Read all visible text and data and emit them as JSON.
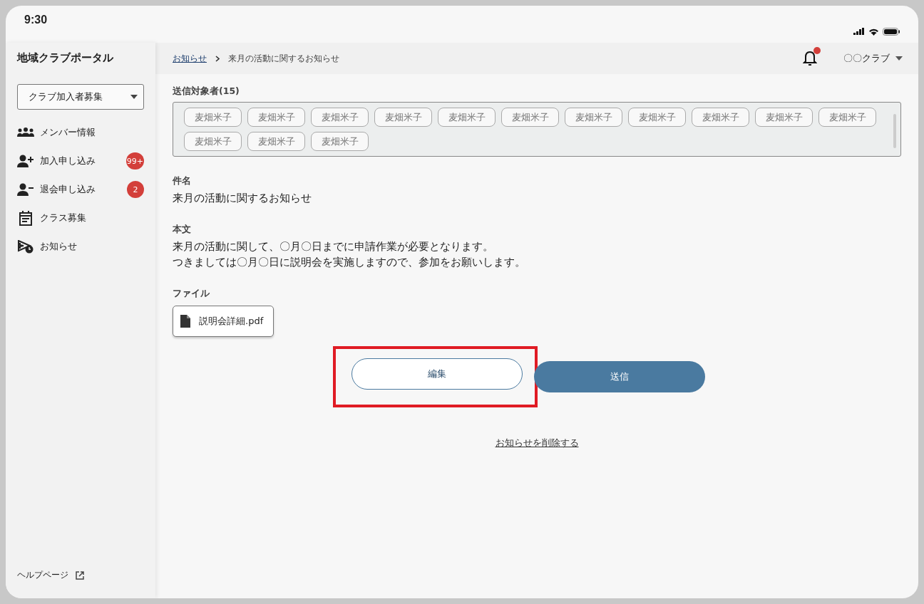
{
  "status_bar": {
    "time": "9:30"
  },
  "sidebar": {
    "title": "地域クラブポータル",
    "club_select": {
      "value": "クラブ加入者募集"
    },
    "items": [
      {
        "kind": "members",
        "label": "メンバー情報"
      },
      {
        "kind": "join",
        "label": "加入申し込み",
        "badge": "99+"
      },
      {
        "kind": "leave",
        "label": "退会申し込み",
        "badge": "2"
      },
      {
        "kind": "calendar",
        "label": "クラス募集"
      },
      {
        "kind": "notice",
        "label": "お知らせ"
      }
    ],
    "help_link": "ヘルプページ"
  },
  "header": {
    "breadcrumb": [
      {
        "label": "お知らせ",
        "link": true
      },
      {
        "label": "来月の活動に関するお知らせ",
        "link": false
      }
    ],
    "notification_dot": true,
    "account": "〇〇クラブ"
  },
  "recipients": {
    "label": "送信対象者(15)",
    "tags": [
      "麦畑米子",
      "麦畑米子",
      "麦畑米子",
      "麦畑米子",
      "麦畑米子",
      "麦畑米子",
      "麦畑米子",
      "麦畑米子",
      "麦畑米子",
      "麦畑米子",
      "麦畑米子",
      "麦畑米子",
      "麦畑米子",
      "麦畑米子"
    ]
  },
  "subject": {
    "label": "件名",
    "value": "来月の活動に関するお知らせ"
  },
  "body": {
    "label": "本文",
    "lines": [
      "来月の活動に関して、〇月〇日までに申請作業が必要となります。",
      "つきましては〇月〇日に説明会を実施しますので、参加をお願いします。"
    ]
  },
  "file": {
    "label": "ファイル",
    "name": "説明会詳細.pdf"
  },
  "buttons": [
    {
      "kind": "outline",
      "label": "編集",
      "highlighted": true
    },
    {
      "kind": "primary",
      "label": "送信",
      "highlighted": false
    }
  ],
  "delete_link": "お知らせを削除する"
}
